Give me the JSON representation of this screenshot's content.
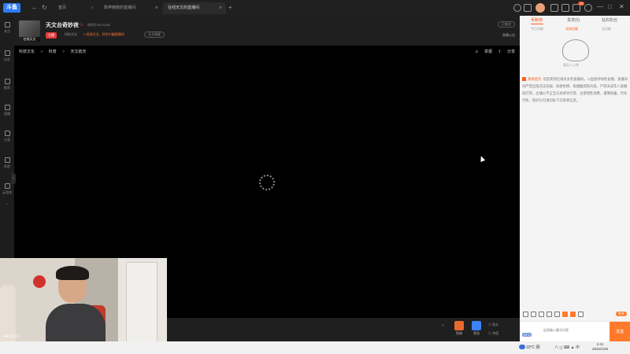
{
  "titlebar": {
    "logo_text": "斗鱼",
    "tabs": [
      {
        "label": "首页",
        "close": ""
      },
      {
        "label": "陈梓楠我的直播间",
        "close": "⊗"
      },
      {
        "label": "在线天文的直播间",
        "close": "⊗"
      }
    ],
    "notification_count": "99",
    "window_controls": [
      "—",
      "□",
      "✕"
    ]
  },
  "sidebar": {
    "items": [
      {
        "label": "关注"
      },
      {
        "label": "历史"
      },
      {
        "label": "推荐"
      },
      {
        "label": "直播"
      },
      {
        "label": "分类"
      },
      {
        "label": "鱼吧"
      },
      {
        "label": "云游戏"
      }
    ]
  },
  "room": {
    "avatar_caption": "在线天文",
    "title": "天文台奇妙夜",
    "room_id": "房间号:5075186",
    "badge": "主播",
    "category": "科技天文",
    "promo": "V 优质天文，科学兴趣直播间",
    "tag": "天文观星",
    "follow": "已关注",
    "notice": "直播公告"
  },
  "player": {
    "breadcrumb": [
      "科技文化",
      "科普",
      "天文航天"
    ],
    "breadcrumb_sep": ">",
    "report": "举报",
    "share": "分享"
  },
  "bottombar": {
    "gifts": [
      {
        "label": "鱼翅",
        "color": "#e8692e"
      },
      {
        "label": "背包",
        "color": "#3b82f6"
      }
    ],
    "text1": "鱼丸",
    "text2": "充值"
  },
  "webcam": {
    "watermark": "341103"
  },
  "chat": {
    "main_tabs": [
      "贡献榜",
      "贵宾(0)",
      "钻石粉丝"
    ],
    "sub_tabs": [
      "今日贡献",
      "本周贡献",
      "总贡献"
    ],
    "empty_caption": "暂无人上榜",
    "system_label": "系统提示:",
    "system_message": "欢迎来到在线天文的直播间，斗鱼倡导绿色直播，直播间内严禁出现违法违规、低俗色情、吸烟酗酒等内容。严禁未成年人直播或打赏，主播以不正当方式诱导打赏、注意理性消费，谨慎防骗，代充代练、购买礼包请勿私下交易等信息。",
    "input_placeholder": "这里输入聊天内容",
    "level": "LV 1",
    "toolbar_chip": "更多",
    "send": "发送"
  },
  "taskbar": {
    "weather": "10°C 阴",
    "time": "1:41",
    "date": "2022/1/28",
    "icons": "∧ ◻ ⌨ ▲ 中"
  }
}
